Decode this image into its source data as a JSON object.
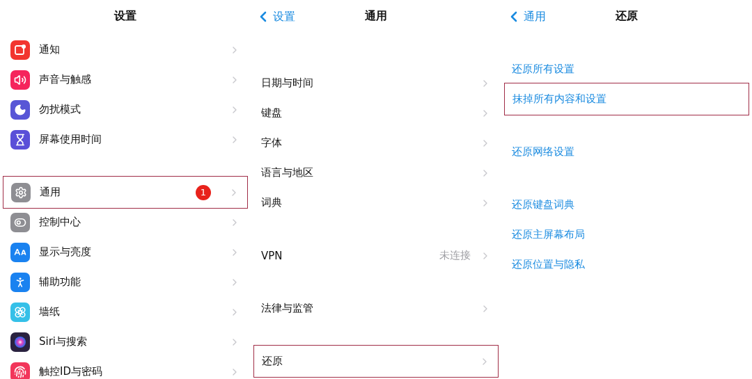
{
  "panels": [
    {
      "title": "设置",
      "scrolled": false,
      "groups": [
        {
          "items": [
            {
              "label": "通知",
              "kind": "nav",
              "color": "#f2352f",
              "highlighted": false
            },
            {
              "label": "声音与触感",
              "kind": "nav",
              "color": "#f5245c",
              "highlighted": false
            },
            {
              "label": "勿扰模式",
              "kind": "nav",
              "color": "#5856d6",
              "highlighted": false
            },
            {
              "label": "屏幕使用时间",
              "kind": "nav",
              "color": "#5a4fd8",
              "highlighted": false
            }
          ]
        },
        {
          "items": [
            {
              "label": "通用",
              "kind": "nav",
              "color": "#8e8e93",
              "badge": "1",
              "highlighted": true
            },
            {
              "label": "控制中心",
              "kind": "nav",
              "color": "#8e8e93",
              "highlighted": false
            },
            {
              "label": "显示与亮度",
              "kind": "nav",
              "color": "#1a82f0",
              "highlighted": false
            },
            {
              "label": "辅助功能",
              "kind": "nav",
              "color": "#1a82f0",
              "highlighted": false
            },
            {
              "label": "墙纸",
              "kind": "nav",
              "color": "#35c0e8",
              "highlighted": false
            },
            {
              "label": "Siri与搜索",
              "kind": "nav",
              "color": "#2a2240",
              "highlighted": false
            },
            {
              "label": "触控ID与密码",
              "kind": "nav",
              "color": "#f2355a",
              "highlighted": false
            }
          ]
        }
      ]
    },
    {
      "title": "通用",
      "back": "设置",
      "scrolled": true,
      "groups": [
        {
          "items": [
            {
              "label": "日期与时间",
              "kind": "nav",
              "highlighted": false
            },
            {
              "label": "键盘",
              "kind": "nav",
              "highlighted": false
            },
            {
              "label": "字体",
              "kind": "nav",
              "highlighted": false
            },
            {
              "label": "语言与地区",
              "kind": "nav",
              "highlighted": false
            },
            {
              "label": "词典",
              "kind": "nav",
              "highlighted": false
            }
          ]
        },
        {
          "items": [
            {
              "label": "VPN",
              "kind": "nav",
              "detail": "未连接",
              "highlighted": false
            }
          ]
        },
        {
          "items": [
            {
              "label": "法律与监管",
              "kind": "nav",
              "highlighted": false
            }
          ]
        },
        {
          "items": [
            {
              "label": "还原",
              "kind": "nav",
              "highlighted": true
            }
          ]
        }
      ]
    },
    {
      "title": "还原",
      "back": "通用",
      "scrolled": false,
      "groups": [
        {
          "items": [
            {
              "label": "还原所有设置",
              "kind": "action",
              "highlighted": false
            },
            {
              "label": "抹掉所有内容和设置",
              "kind": "action",
              "highlighted": true
            }
          ]
        },
        {
          "items": [
            {
              "label": "还原网络设置",
              "kind": "action",
              "highlighted": false
            }
          ]
        },
        {
          "items": [
            {
              "label": "还原键盘词典",
              "kind": "action",
              "highlighted": false
            },
            {
              "label": "还原主屏幕布局",
              "kind": "action",
              "highlighted": false
            },
            {
              "label": "还原位置与隐私",
              "kind": "action",
              "highlighted": false
            }
          ]
        }
      ]
    }
  ]
}
